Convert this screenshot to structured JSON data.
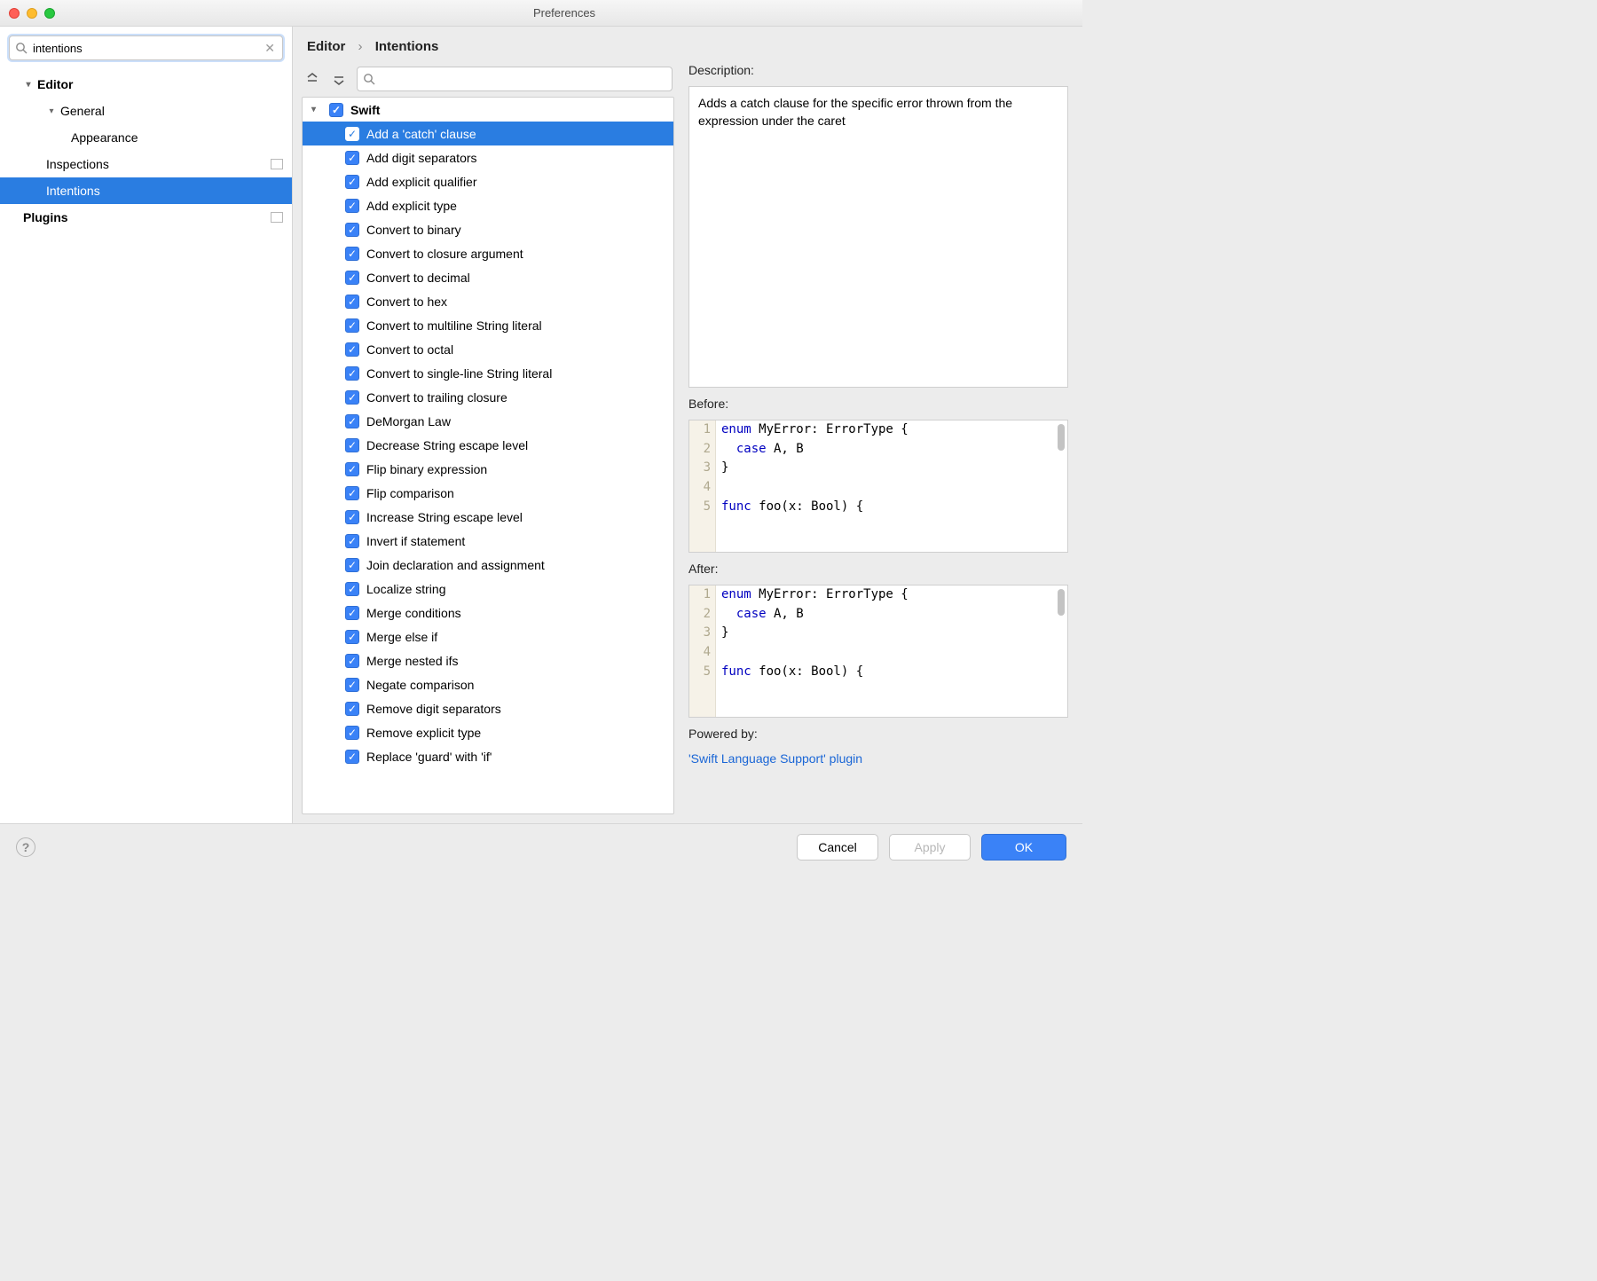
{
  "window": {
    "title": "Preferences"
  },
  "search": {
    "value": "intentions"
  },
  "sidebar": {
    "items": [
      {
        "label": "Editor"
      },
      {
        "label": "General"
      },
      {
        "label": "Appearance"
      },
      {
        "label": "Inspections"
      },
      {
        "label": "Intentions"
      },
      {
        "label": "Plugins"
      }
    ]
  },
  "breadcrumb": {
    "root": "Editor",
    "leaf": "Intentions"
  },
  "filter": {
    "placeholder": ""
  },
  "intentions": {
    "group": "Swift",
    "items": [
      "Add a 'catch' clause",
      "Add digit separators",
      "Add explicit qualifier",
      "Add explicit type",
      "Convert to binary",
      "Convert to closure argument",
      "Convert to decimal",
      "Convert to hex",
      "Convert to multiline String literal",
      "Convert to octal",
      "Convert to single-line String literal",
      "Convert to trailing closure",
      "DeMorgan Law",
      "Decrease String escape level",
      "Flip binary expression",
      "Flip comparison",
      "Increase String escape level",
      "Invert if statement",
      "Join declaration and assignment",
      "Localize string",
      "Merge conditions",
      "Merge else if",
      "Merge nested ifs",
      "Negate comparison",
      "Remove digit separators",
      "Remove explicit type",
      "Replace 'guard' with 'if'"
    ],
    "selected_index": 0
  },
  "description": {
    "label": "Description:",
    "text": "Adds a catch clause for the specific error thrown from the expression under the caret"
  },
  "before": {
    "label": "Before:",
    "lines": [
      {
        "n": "1",
        "kw": "enum",
        "rest": " MyError: ErrorType {"
      },
      {
        "n": "2",
        "kw": "  case",
        "rest": " A, B"
      },
      {
        "n": "3",
        "kw": "",
        "rest": "}"
      },
      {
        "n": "4",
        "kw": "",
        "rest": ""
      },
      {
        "n": "5",
        "kw": "func",
        "rest": " foo(x: Bool) {"
      }
    ]
  },
  "after": {
    "label": "After:",
    "lines": [
      {
        "n": "1",
        "kw": "enum",
        "rest": " MyError: ErrorType {"
      },
      {
        "n": "2",
        "kw": "  case",
        "rest": " A, B"
      },
      {
        "n": "3",
        "kw": "",
        "rest": "}"
      },
      {
        "n": "4",
        "kw": "",
        "rest": ""
      },
      {
        "n": "5",
        "kw": "func",
        "rest": " foo(x: Bool) {"
      }
    ]
  },
  "powered": {
    "label": "Powered by:",
    "link": "'Swift Language Support' plugin"
  },
  "buttons": {
    "cancel": "Cancel",
    "apply": "Apply",
    "ok": "OK"
  }
}
